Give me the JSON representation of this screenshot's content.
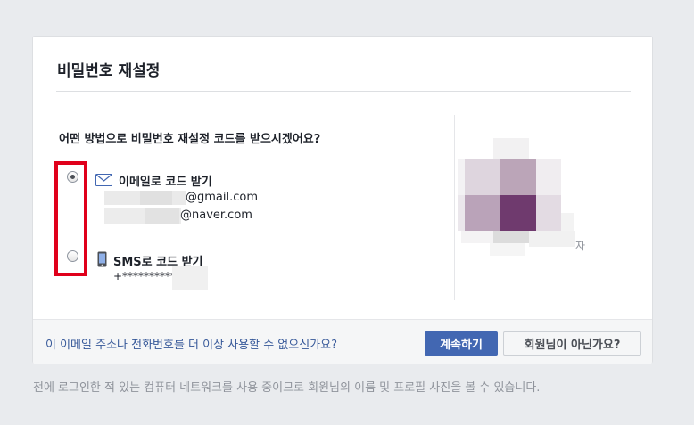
{
  "card": {
    "title": "비밀번호 재설정",
    "question": "어떤 방법으로 비밀번호 재설정 코드를 받으시겠어요?"
  },
  "options": {
    "email": {
      "label": "이메일로 코드 받기",
      "icon": "envelope-icon",
      "selected": true,
      "contacts": [
        "@gmail.com",
        "@naver.com"
      ]
    },
    "sms": {
      "label": "SMS로 코드 받기",
      "icon": "phone-icon",
      "selected": false,
      "contact": "+**********"
    }
  },
  "profile": {
    "name_tail": "자"
  },
  "footer": {
    "link": "이 이메일 주소나 전화번호를 더 이상 사용할 수 없으신가요?",
    "continue_label": "계속하기",
    "not_you_label": "회원님이 아닌가요?"
  },
  "bottom_note": "전에 로그인한 적 있는 컴퓨터 네트워크를 사용 중이므로 회원님의 이름 및 프로필 사진을 볼 수 있습니다.",
  "colors": {
    "page_bg": "#e9ebee",
    "primary": "#4267b2",
    "link": "#365899",
    "highlight": "#e0001b"
  }
}
